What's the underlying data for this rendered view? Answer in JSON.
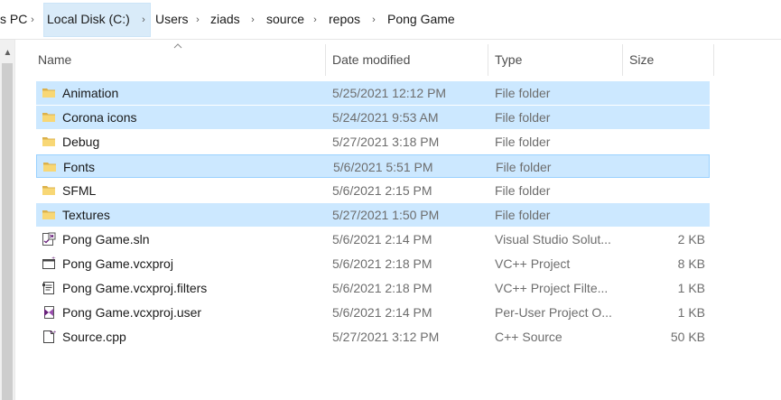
{
  "breadcrumb": {
    "items": [
      "s PC",
      "Local Disk (C:)",
      "Users",
      "ziads",
      "source",
      "repos",
      "Pong Game"
    ]
  },
  "columns": {
    "name": "Name",
    "date": "Date modified",
    "type": "Type",
    "size": "Size"
  },
  "files": [
    {
      "name": "Animation",
      "date": "5/25/2021 12:12 PM",
      "type": "File folder",
      "size": "",
      "icon": "folder-icon",
      "state": "selected"
    },
    {
      "name": "Corona icons",
      "date": "5/24/2021 9:53 AM",
      "type": "File folder",
      "size": "",
      "icon": "folder-icon",
      "state": "selected"
    },
    {
      "name": "Debug",
      "date": "5/27/2021 3:18 PM",
      "type": "File folder",
      "size": "",
      "icon": "folder-icon",
      "state": ""
    },
    {
      "name": "Fonts",
      "date": "5/6/2021 5:51 PM",
      "type": "File folder",
      "size": "",
      "icon": "folder-icon",
      "state": "focused"
    },
    {
      "name": "SFML",
      "date": "5/6/2021 2:15 PM",
      "type": "File folder",
      "size": "",
      "icon": "folder-icon",
      "state": ""
    },
    {
      "name": "Textures",
      "date": "5/27/2021 1:50 PM",
      "type": "File folder",
      "size": "",
      "icon": "folder-icon",
      "state": "selected"
    },
    {
      "name": "Pong Game.sln",
      "date": "5/6/2021 2:14 PM",
      "type": "Visual Studio Solut...",
      "size": "2 KB",
      "icon": "vs-solution-icon",
      "state": ""
    },
    {
      "name": "Pong Game.vcxproj",
      "date": "5/6/2021 2:18 PM",
      "type": "VC++ Project",
      "size": "8 KB",
      "icon": "vcxproj-icon",
      "state": ""
    },
    {
      "name": "Pong Game.vcxproj.filters",
      "date": "5/6/2021 2:18 PM",
      "type": "VC++ Project Filte...",
      "size": "1 KB",
      "icon": "filters-icon",
      "state": ""
    },
    {
      "name": "Pong Game.vcxproj.user",
      "date": "5/6/2021 2:14 PM",
      "type": "Per-User Project O...",
      "size": "1 KB",
      "icon": "vs-user-icon",
      "state": ""
    },
    {
      "name": "Source.cpp",
      "date": "5/27/2021 3:12 PM",
      "type": "C++ Source",
      "size": "50 KB",
      "icon": "cpp-file-icon",
      "state": ""
    }
  ],
  "colors": {
    "selection": "#cce8ff",
    "focus_border": "#99d1ff",
    "folder": "#f8d775",
    "vs_purple": "#68217a"
  }
}
